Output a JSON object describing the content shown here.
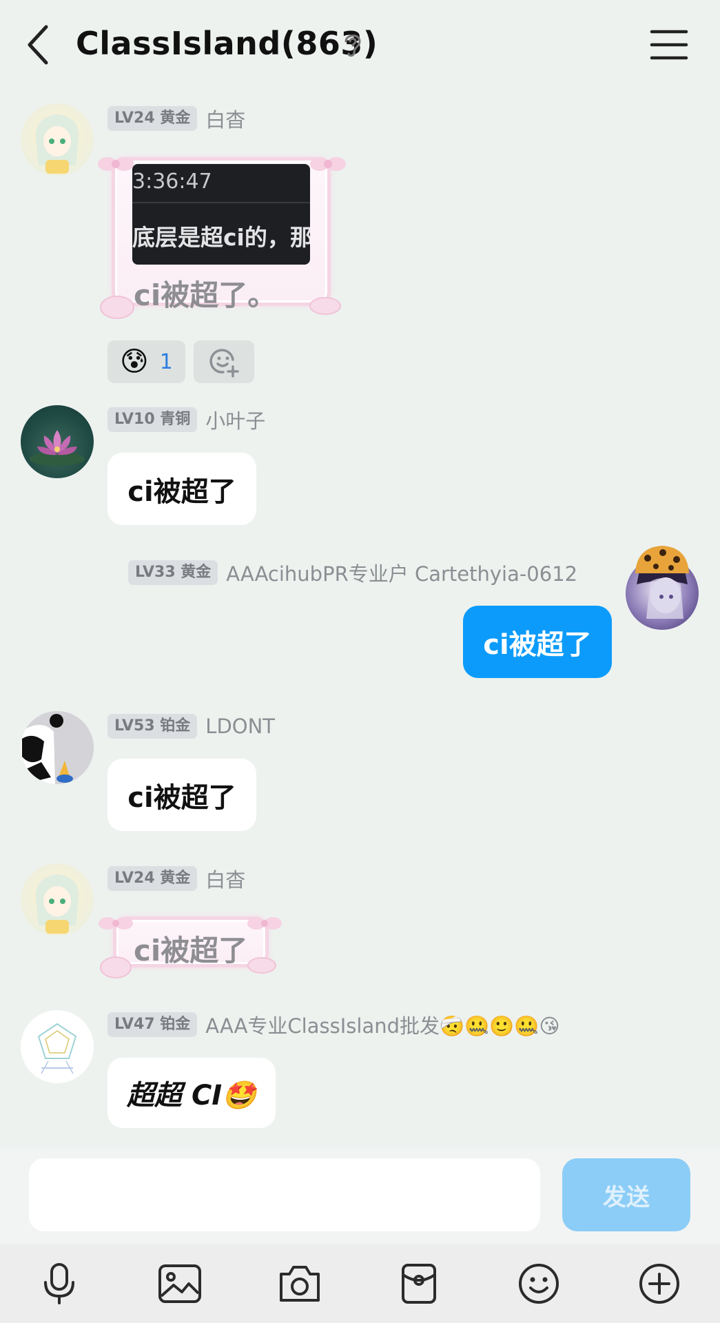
{
  "header": {
    "title": "ClassIsland(863)"
  },
  "messages": [
    {
      "badge": "LV24 黄金",
      "sender": "白杳",
      "quote": {
        "time": "3:36:47",
        "body": "底层是超ci的，那"
      },
      "text": "ci被超了。",
      "reactions": [
        {
          "emoji": "😰",
          "count": "1"
        }
      ]
    },
    {
      "badge": "LV10 青铜",
      "sender": "小叶子",
      "text": "ci被超了"
    },
    {
      "badge": "LV33 黄金",
      "sender": "AAAcihubPR专业户 Cartethyia-0612",
      "text": "ci被超了"
    },
    {
      "badge": "LV53 铂金",
      "sender": "LDONT",
      "text": "ci被超了"
    },
    {
      "badge": "LV24 黄金",
      "sender": "白杳",
      "text": "ci被超了"
    },
    {
      "badge": "LV47 铂金",
      "sender": "AAA专业ClassIsland批发🤕🤐🙂🤐😘",
      "text": "超超 CI🤩"
    }
  ],
  "input": {
    "placeholder": "",
    "send_label": "发送"
  },
  "toolbar": {
    "items": [
      "microphone-icon",
      "image-icon",
      "camera-icon",
      "red-packet-icon",
      "emoji-icon",
      "plus-icon"
    ]
  },
  "colors": {
    "background": "#edf2ef",
    "my_bubble": "#0c9bfa",
    "send_button": "#8ccdf7"
  }
}
